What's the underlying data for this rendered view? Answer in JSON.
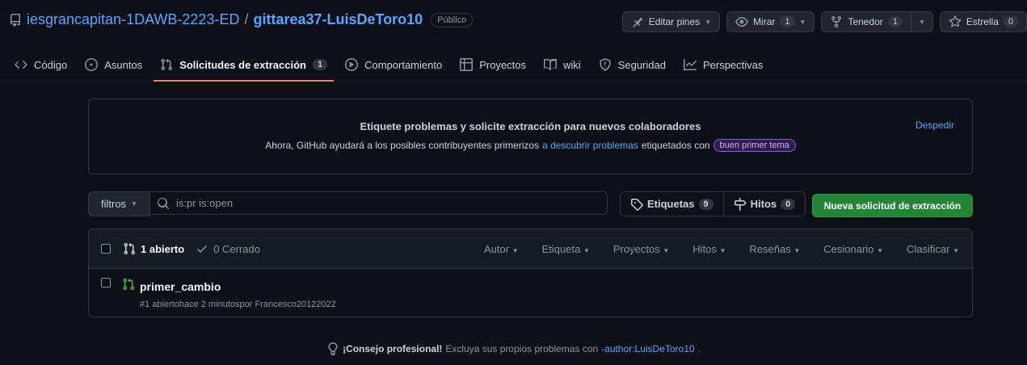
{
  "repo": {
    "owner": "iesgrancapitan-1DAWB-2223-ED",
    "separator": "/",
    "name": "gittarea37-LuisDeToro10",
    "visibility": "Público"
  },
  "actions": {
    "pins_label": "Editar pines",
    "watch_label": "Mirar",
    "watch_count": "1",
    "fork_label": "Tenedor",
    "fork_count": "1",
    "star_label": "Estrella",
    "star_count": "0"
  },
  "nav": {
    "code": "Código",
    "issues": "Asuntos",
    "pulls": "Solicitudes de extracción",
    "pulls_count": "1",
    "actions": "Comportamiento",
    "projects": "Proyectos",
    "wiki": "wiki",
    "security": "Seguridad",
    "insights": "Perspectivas"
  },
  "banner": {
    "title": "Etiquete problemas y solicite extracción para nuevos colaboradores",
    "text_before": "Ahora, GitHub ayudará a los posibles contribuyentes primerizos",
    "link": "a descubrir problemas",
    "text_after": "etiquetados con",
    "label": "buen primer tema",
    "dismiss": "Despedir"
  },
  "filters": {
    "button": "filtros",
    "query": "is:pr is:open",
    "labels": "Etiquetas",
    "labels_count": "9",
    "milestones": "Hitos",
    "milestones_count": "0",
    "new_pr": "Nueva solicitud de extracción"
  },
  "list": {
    "open": "1 abierto",
    "closed": "0 Cerrado",
    "sort": [
      "Autor",
      "Etiqueta",
      "Proyectos",
      "Hitos",
      "Reseñas",
      "Cesionario",
      "Clasificar"
    ],
    "items": [
      {
        "title": "primer_cambio",
        "meta": "#1 abiertohace 2 minutospor Francesco20122022"
      }
    ]
  },
  "tip": {
    "strong": "¡Consejo profesional!",
    "text": "Excluya sus propios problemas con",
    "link": "-author:LuisDeToro10",
    "end": "."
  },
  "colors": {
    "accent": "#58a6ff",
    "primary_button": "#238636",
    "active_tab": "#f78166",
    "open_state": "#3fb950"
  }
}
